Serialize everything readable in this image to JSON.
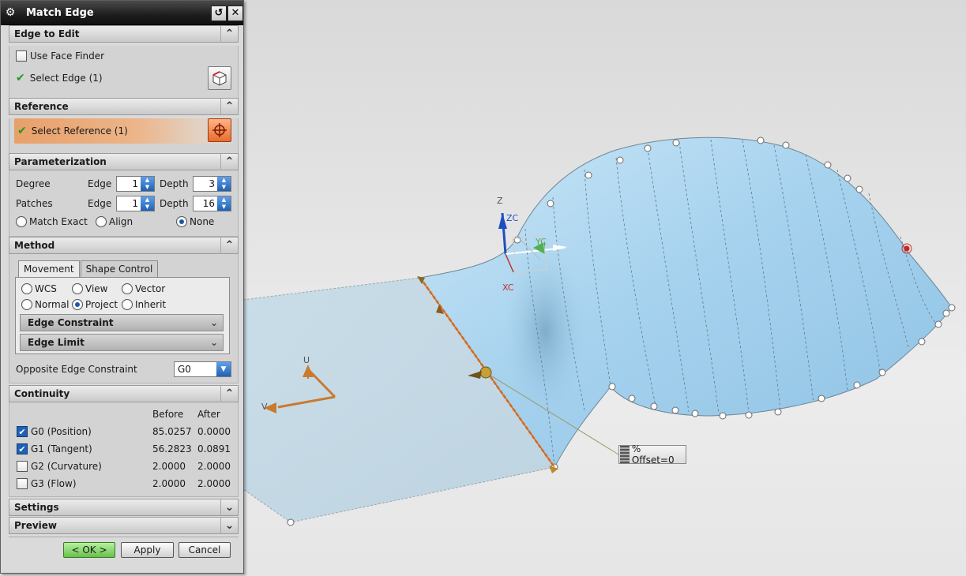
{
  "dialog": {
    "title": "Match Edge",
    "sections": {
      "edge_to_edit": {
        "header": "Edge to Edit",
        "use_face_finder": "Use Face Finder",
        "select_edge": "Select Edge (1)"
      },
      "reference": {
        "header": "Reference",
        "select_reference": "Select Reference (1)"
      },
      "parameterization": {
        "header": "Parameterization",
        "degree_label": "Degree",
        "patches_label": "Patches",
        "edge_label": "Edge",
        "depth_label": "Depth",
        "degree_edge": "1",
        "degree_depth": "3",
        "patches_edge": "1",
        "patches_depth": "16",
        "options": [
          "Match Exact",
          "Align",
          "None"
        ],
        "selected": "None"
      },
      "method": {
        "header": "Method",
        "tabs": [
          "Movement",
          "Shape Control"
        ],
        "active_tab": "Movement",
        "movement_options": [
          "WCS",
          "View",
          "Vector",
          "Normal",
          "Project",
          "Inherit"
        ],
        "selected": "Project",
        "edge_constraint": "Edge Constraint",
        "edge_limit": "Edge Limit",
        "opposite_label": "Opposite Edge Constraint",
        "opposite_value": "G0"
      },
      "continuity": {
        "header": "Continuity",
        "col_before": "Before",
        "col_after": "After",
        "rows": [
          {
            "label": "G0 (Position)",
            "checked": true,
            "before": "85.0257",
            "after": "0.0000"
          },
          {
            "label": "G1 (Tangent)",
            "checked": true,
            "before": "56.2823",
            "after": "0.0891"
          },
          {
            "label": "G2 (Curvature)",
            "checked": false,
            "before": "2.0000",
            "after": "2.0000"
          },
          {
            "label": "G3 (Flow)",
            "checked": false,
            "before": "2.0000",
            "after": "2.0000"
          }
        ]
      },
      "settings": {
        "header": "Settings"
      },
      "preview": {
        "header": "Preview"
      }
    },
    "buttons": {
      "ok": "< OK >",
      "apply": "Apply",
      "cancel": "Cancel"
    }
  },
  "viewport": {
    "offset_tag": "% Offset=0",
    "triad_labels": {
      "z": "Z",
      "zc": "ZC",
      "yc": "YC",
      "xc": "XC",
      "u": "U",
      "v": "V"
    },
    "colors": {
      "surface": "#a9d3ec",
      "edge_highlight": "#e8843a",
      "background": "#e3e3e3"
    }
  }
}
